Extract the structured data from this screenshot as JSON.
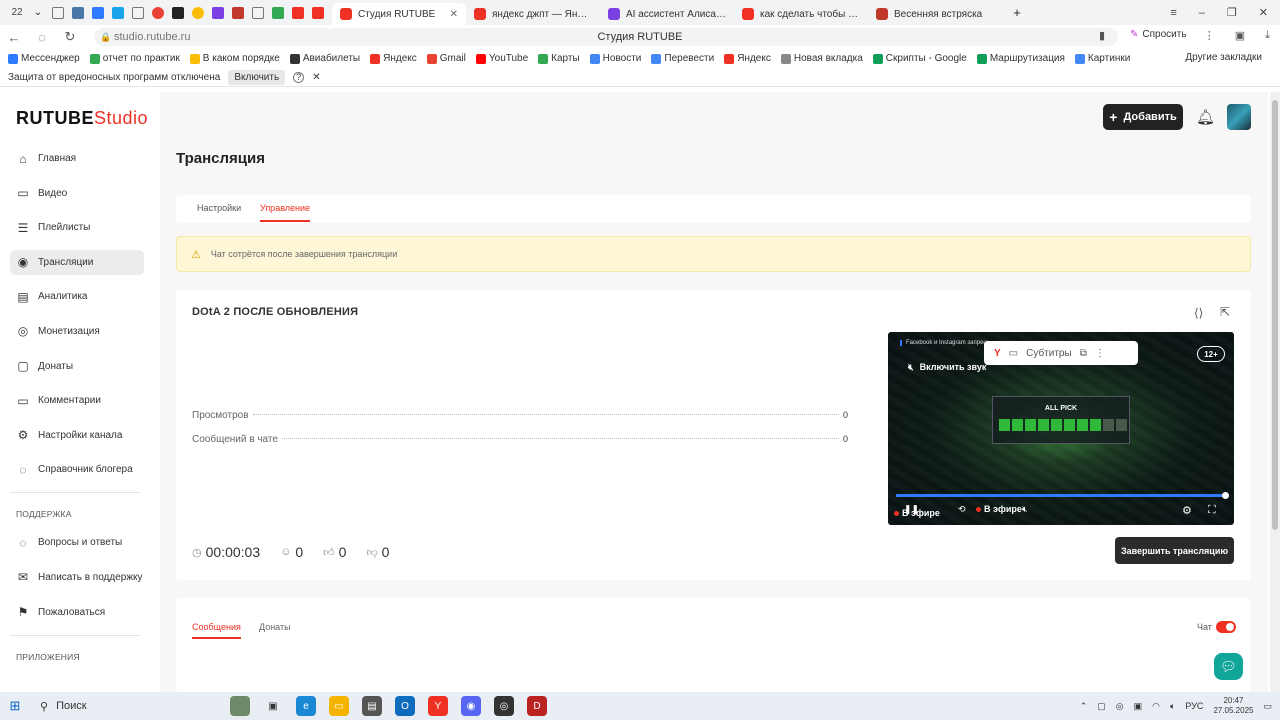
{
  "browser": {
    "tab_counter": "22",
    "tabs": [
      {
        "label": "Студия RUTUBE",
        "color": "#ef3124",
        "active": true
      },
      {
        "label": "яндекс джпт — Яндекс:н",
        "color": "#ef3124",
        "active": false
      },
      {
        "label": "AI ассистент Алиса в чат",
        "color": "#7b3fe4",
        "active": false
      },
      {
        "label": "как сделать чтобы обсуж",
        "color": "#ef3124",
        "active": false
      },
      {
        "label": "Весенняя встряска",
        "color": "#c0392b",
        "active": false
      }
    ],
    "url": "studio.rutube.ru",
    "page_title": "Студия RUTUBE",
    "ask_label": "Спросить",
    "bookmarks": [
      {
        "label": "Мессенджер",
        "color": "#2d7cff"
      },
      {
        "label": "отчет по практик",
        "color": "#34a853"
      },
      {
        "label": "В каком порядке",
        "color": "#fbbc05"
      },
      {
        "label": "Авиабилеты",
        "color": "#333333"
      },
      {
        "label": "Яндекс",
        "color": "#ef3124"
      },
      {
        "label": "Gmail",
        "color": "#ea4335"
      },
      {
        "label": "YouTube",
        "color": "#ff0000"
      },
      {
        "label": "Карты",
        "color": "#34a853"
      },
      {
        "label": "Новости",
        "color": "#4285f4"
      },
      {
        "label": "Перевести",
        "color": "#4285f4"
      },
      {
        "label": "Яндекс",
        "color": "#ef3124"
      },
      {
        "label": "Новая вкладка",
        "color": "#888888"
      },
      {
        "label": "Скрипты - Google",
        "color": "#0f9d58"
      },
      {
        "label": "Маршрутизация",
        "color": "#0f9d58"
      },
      {
        "label": "Картинки",
        "color": "#4285f4"
      }
    ],
    "other_bookmarks": "Другие закладки",
    "infobar_text": "Защита от вредоносных программ отключена",
    "infobar_enable": "Включить"
  },
  "header": {
    "logo_main": "RUTUBE",
    "logo_studio": "Studio",
    "add_label": "Добавить"
  },
  "sidebar": {
    "items": [
      {
        "label": "Главная",
        "icon": "home-icon",
        "glyph": "⌂"
      },
      {
        "label": "Видео",
        "icon": "video-icon",
        "glyph": "▭"
      },
      {
        "label": "Плейлисты",
        "icon": "playlist-icon",
        "glyph": "☰"
      },
      {
        "label": "Трансляции",
        "icon": "broadcast-icon",
        "glyph": "◉"
      },
      {
        "label": "Аналитика",
        "icon": "analytics-icon",
        "glyph": "▤"
      },
      {
        "label": "Монетизация",
        "icon": "monetization-icon",
        "glyph": "◎"
      },
      {
        "label": "Донаты",
        "icon": "donate-icon",
        "glyph": "▢"
      },
      {
        "label": "Комментарии",
        "icon": "comments-icon",
        "glyph": "▭"
      },
      {
        "label": "Настройки канала",
        "icon": "settings-icon",
        "glyph": "⚙"
      },
      {
        "label": "Справочник блогера",
        "icon": "guide-icon",
        "glyph": "◌"
      }
    ],
    "support_heading": "ПОДДЕРЖКА",
    "support_items": [
      {
        "label": "Вопросы и ответы",
        "icon": "faq-icon",
        "glyph": "◌"
      },
      {
        "label": "Написать в поддержку",
        "icon": "mail-icon",
        "glyph": "✉"
      },
      {
        "label": "Пожаловаться",
        "icon": "flag-icon",
        "glyph": "⚑"
      }
    ],
    "apps_heading": "ПРИЛОЖЕНИЯ"
  },
  "main": {
    "title": "Трансляция",
    "tabs": [
      "Настройки",
      "Управление"
    ],
    "alert": "Чат сотрётся после завершения трансляции",
    "stream": {
      "title": "DOtA 2 ПОСЛЕ ОБНОВЛЕНИЯ",
      "stats": [
        {
          "label": "Просмотров",
          "value": "0"
        },
        {
          "label": "Сообщений в чате",
          "value": "0"
        }
      ],
      "duration": "00:00:03",
      "viewers": "0",
      "likes": "0",
      "dislikes": "0",
      "end_button": "Завершить трансляцию"
    },
    "player": {
      "news_text": "Facebook и Instagram запрещ",
      "unmute_label": "Включить звук",
      "age_rating": "12+",
      "overlay_subtitles": "Субтитры",
      "allpick_title": "ALL PICK",
      "live_label": "В эфире",
      "live_label_left": "В эфире",
      "progress": 1.0
    },
    "chat_tabs": [
      "Сообщения",
      "Донаты"
    ],
    "chat_toggle_label": "Чат",
    "chat_toggle_on": true
  },
  "taskbar": {
    "search_label": "Поиск",
    "lang": "РУС",
    "time": "20:47",
    "date": "27.05.2025"
  }
}
